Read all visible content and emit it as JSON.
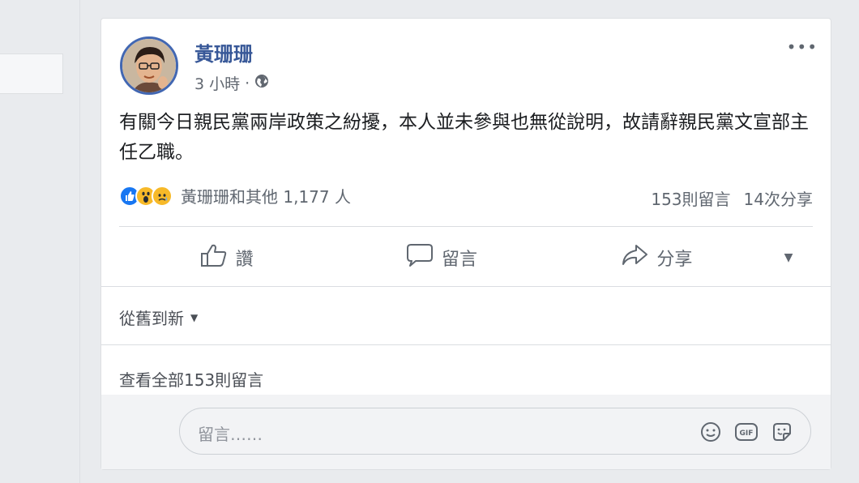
{
  "post": {
    "author": "黃珊珊",
    "time": "3 小時",
    "separator": "·",
    "text": "有關今日親民黨兩岸政策之紛擾，本人並未參與也無從說明，故請辭親民黨文宣部主任乙職。",
    "reactions_summary": "黃珊珊和其他 1,177 人",
    "comments_count": "153則留言",
    "shares_count": "14次分享"
  },
  "actions": {
    "like": "讚",
    "comment": "留言",
    "share": "分享"
  },
  "sort": {
    "label": "從舊到新"
  },
  "comments": {
    "view_all": "查看全部153則留言"
  },
  "composer": {
    "placeholder": "留言……"
  },
  "colors": {
    "author": "#385898",
    "like_blue": "#1877f2",
    "reaction_yellow": "#f7b928"
  },
  "icons": [
    "globe-icon",
    "more-icon",
    "like-icon",
    "wow-icon",
    "sad-icon",
    "thumbs-up-icon",
    "comment-bubble-icon",
    "share-arrow-icon",
    "caret-down-icon",
    "emoji-icon",
    "gif-icon",
    "sticker-icon"
  ]
}
